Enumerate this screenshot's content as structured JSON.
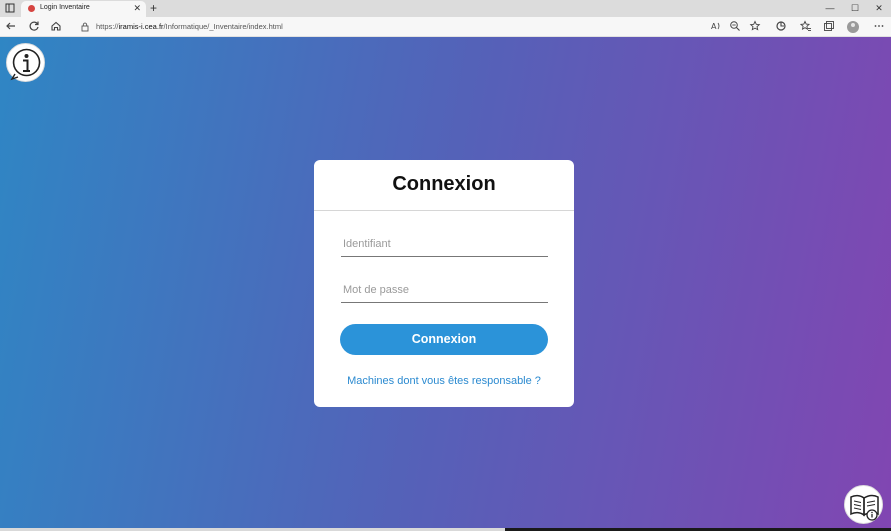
{
  "browser": {
    "tab_title": "Login Inventaire",
    "tab_close": "✕",
    "new_tab": "+",
    "url_prefix": "https://",
    "url_host": "iramis-i.cea.fr",
    "url_path": "/Informatique/_Inventaire/index.html",
    "window_controls": [
      "—",
      "☐",
      "✕"
    ],
    "toolbar_icons": [
      "read-aloud-icon",
      "zoom-icon",
      "favorite-add-icon",
      "extensions-icon",
      "favorites-icon",
      "collections-icon",
      "profile-icon",
      "more-icon"
    ]
  },
  "login": {
    "title": "Connexion",
    "username_placeholder": "Identifiant",
    "password_placeholder": "Mot de passe",
    "submit_label": "Connexion",
    "responsible_link": "Machines dont vous êtes responsable ?"
  },
  "colors": {
    "gradient_start": "#2f86c4",
    "gradient_end": "#8146b2",
    "button": "#2b93d9",
    "link": "#2b8ad0"
  }
}
